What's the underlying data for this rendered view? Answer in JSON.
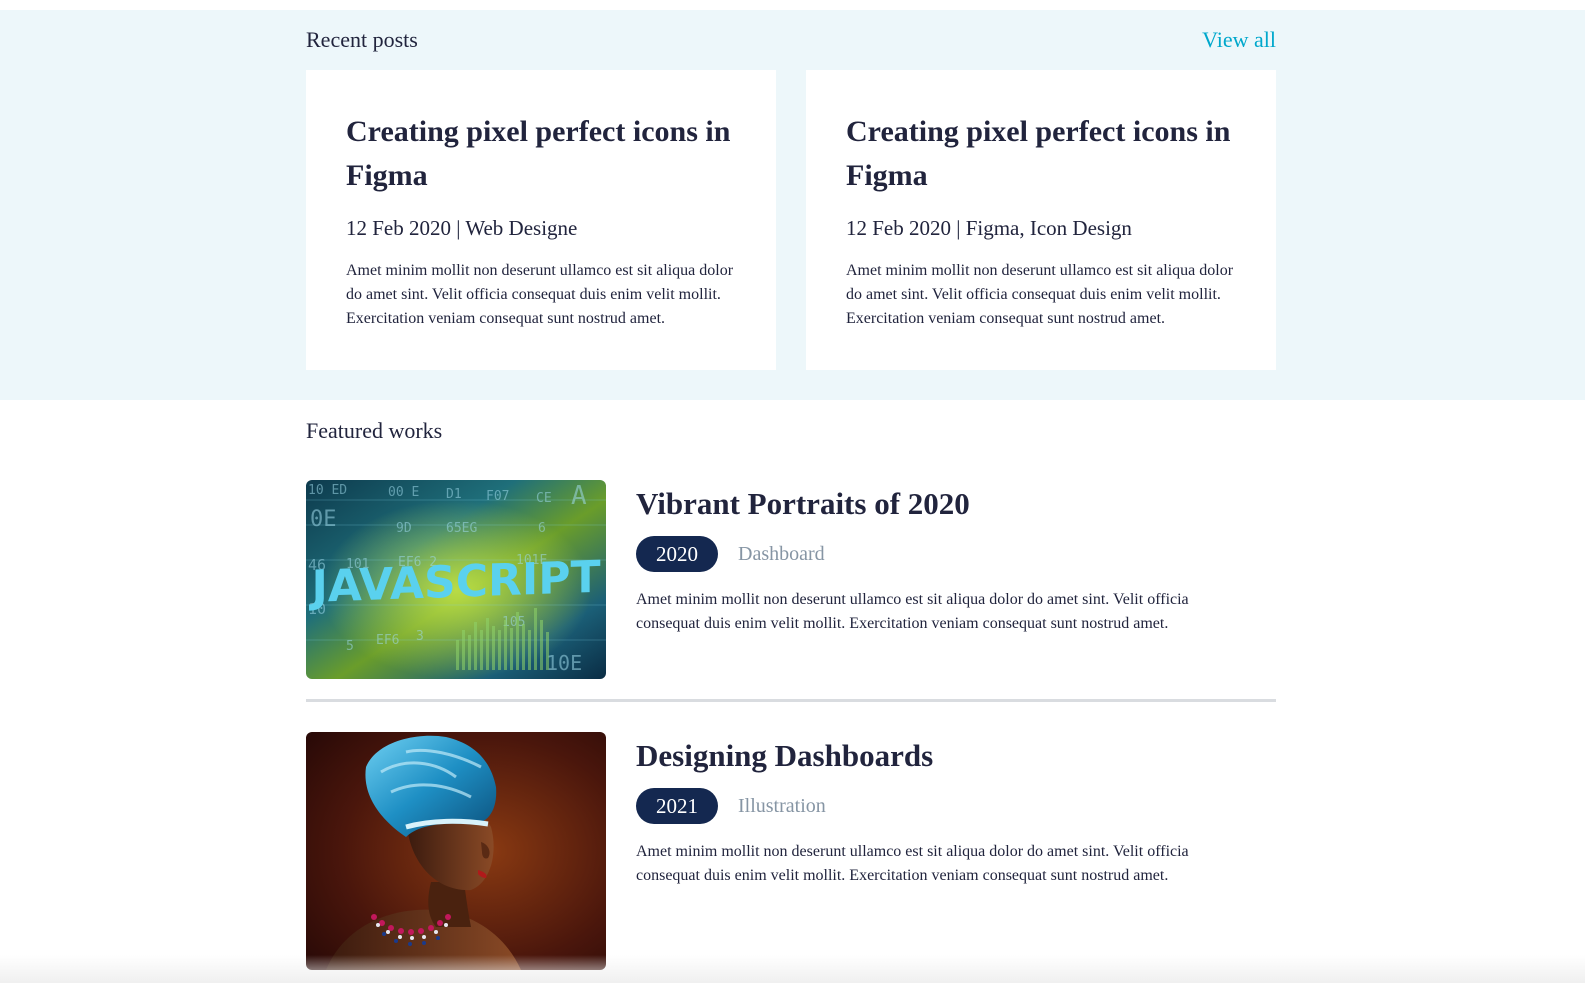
{
  "recent_posts": {
    "title": "Recent posts",
    "view_all_label": "View all",
    "posts": [
      {
        "title": "Creating pixel perfect icons in Figma",
        "meta": "12 Feb 2020 | Web Designe",
        "excerpt": "Amet minim mollit non deserunt ullamco est sit aliqua dolor do amet sint. Velit officia consequat duis enim velit mollit. Exercitation veniam consequat sunt nostrud amet."
      },
      {
        "title": "Creating pixel perfect icons in Figma",
        "meta": "12 Feb 2020 | Figma, Icon Design",
        "excerpt": "Amet minim mollit non deserunt ullamco est sit aliqua dolor do amet sint. Velit officia consequat duis enim velit mollit. Exercitation veniam consequat sunt nostrud amet."
      }
    ]
  },
  "featured_works": {
    "title": "Featured works",
    "works": [
      {
        "title": "Vibrant Portraits of 2020",
        "year": "2020",
        "category": "Dashboard",
        "description": "Amet minim mollit non deserunt ullamco est sit aliqua dolor do amet sint. Velit officia consequat duis enim velit mollit. Exercitation veniam consequat sunt nostrud amet.",
        "image_text": "JAVASCRIPT",
        "image_code_text": [
          "10 ED",
          "00 E",
          "D1",
          "F07",
          "CE",
          "0E",
          "A",
          "9D",
          "65EG",
          "6",
          "46",
          "101",
          "EF6 2",
          "101E",
          "10",
          "3",
          "105",
          "5",
          "EF6",
          "10E"
        ]
      },
      {
        "title": "Designing Dashboards",
        "year": "2021",
        "category": "Illustration",
        "description": "Amet minim mollit non deserunt ullamco est sit aliqua dolor do amet sint. Velit officia consequat duis enim velit mollit. Exercitation veniam consequat sunt nostrud amet."
      }
    ]
  },
  "colors": {
    "accent": "#00a8cc",
    "badge": "#142850",
    "section_bg": "#edf7fa",
    "text": "#21243d",
    "muted": "#8695a4"
  }
}
